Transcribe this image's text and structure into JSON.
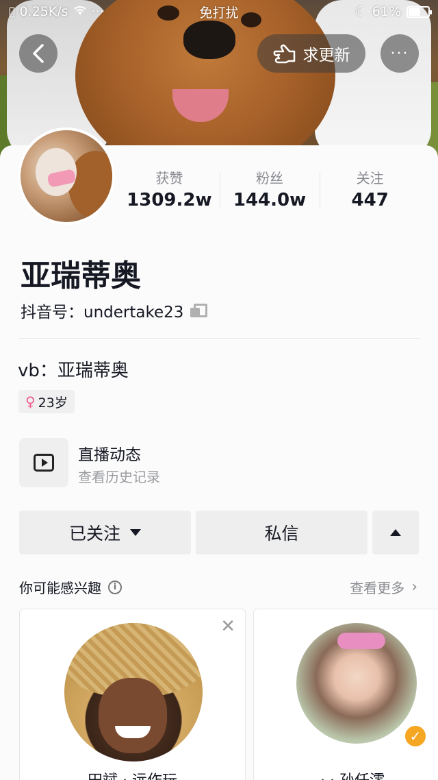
{
  "status_bar": {
    "net_speed": "0.25K/s",
    "dots": "···",
    "mode": "免打扰",
    "battery_percent": "61%",
    "battery_level": 0.61
  },
  "header": {
    "update_label": "求更新",
    "more_label": "···"
  },
  "profile": {
    "stats": [
      {
        "label": "获赞",
        "value": "1309.2w"
      },
      {
        "label": "粉丝",
        "value": "144.0w"
      },
      {
        "label": "关注",
        "value": "447"
      }
    ],
    "name": "亚瑞蒂奥",
    "douyin_id": "抖音号：undertake23",
    "bio": "vb：亚瑞蒂奥",
    "age": "23岁",
    "gender_symbol": "♀"
  },
  "live": {
    "title": "直播动态",
    "subtitle": "查看历史记录"
  },
  "actions": {
    "follow_label": "已关注",
    "message_label": "私信"
  },
  "suggestions": {
    "title": "你可能感兴趣",
    "info_glyph": "i",
    "see_more": "查看更多",
    "items": [
      {
        "name": "田斌 · 远作玩"
      },
      {
        "name": "· · 孙任澪"
      }
    ]
  },
  "colors": {
    "accent_female": "#f25b8f",
    "verified_badge": "#f5a623",
    "button_bg": "#eeeeee"
  }
}
